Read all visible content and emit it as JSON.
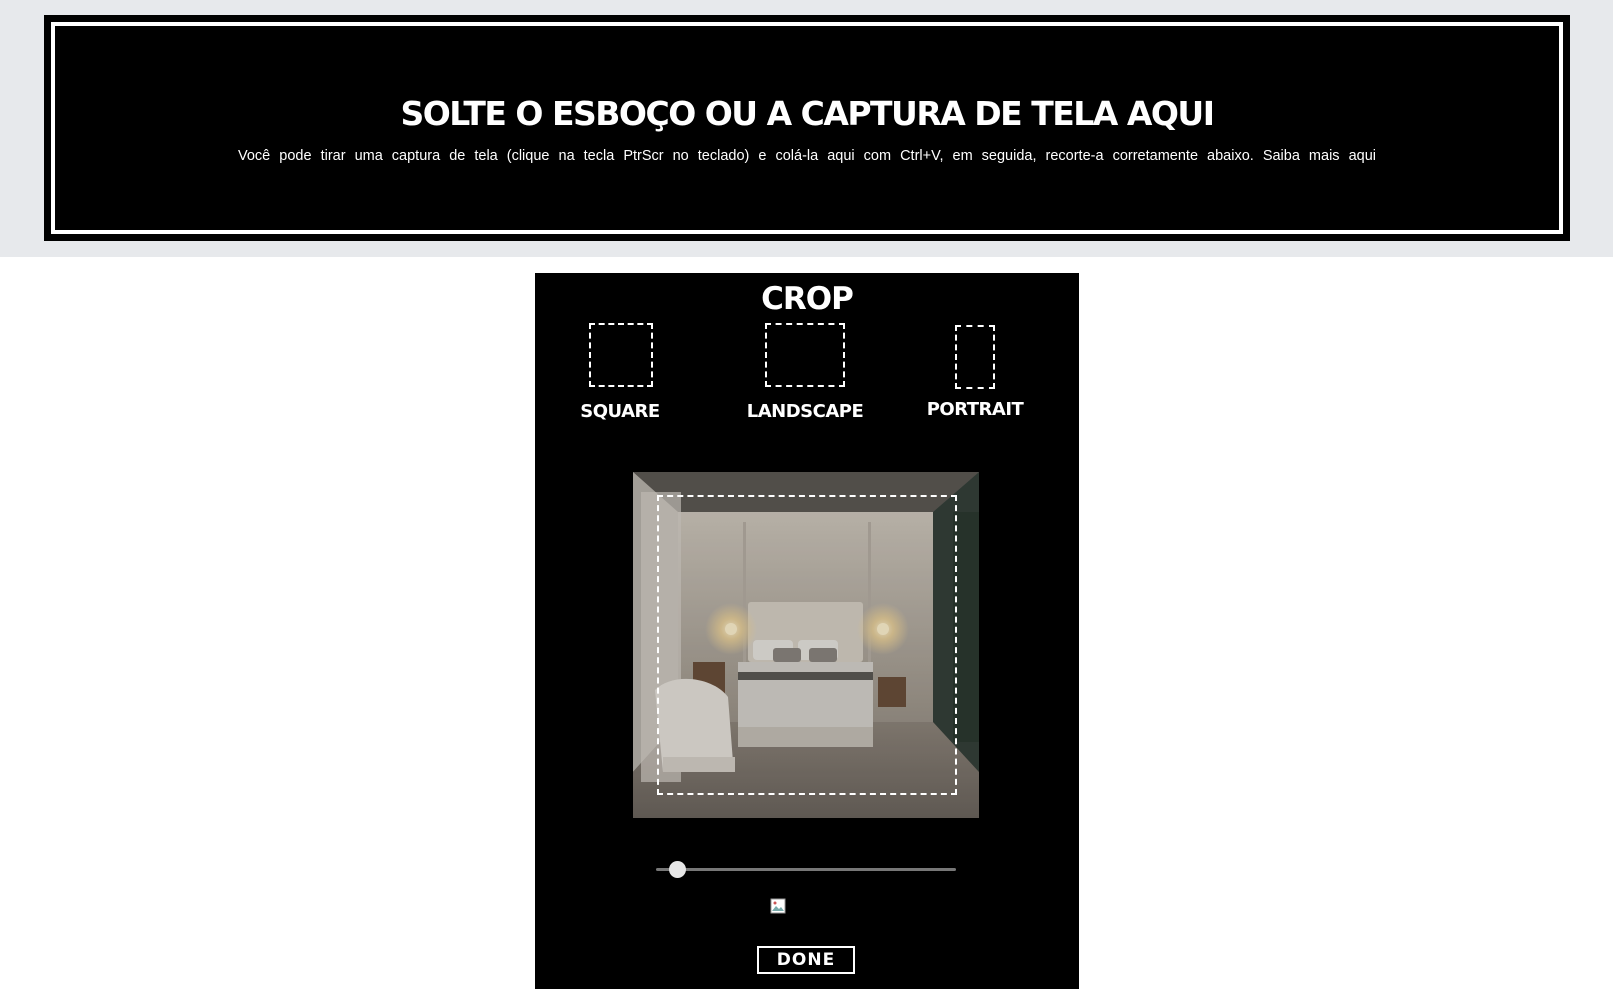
{
  "drop_zone": {
    "title": "SOLTE O ESBOÇO OU A CAPTURA DE TELA AQUI",
    "description": "Você pode tirar uma captura de tela (clique na tecla PtrScr no teclado) e colá-la aqui com Ctrl+V, em seguida, recorte-a corretamente abaixo. Saiba mais aqui"
  },
  "crop": {
    "title": "CROP",
    "options": [
      {
        "label": "SQUARE",
        "icon": "square-ratio-icon"
      },
      {
        "label": "LANDSCAPE",
        "icon": "landscape-ratio-icon"
      },
      {
        "label": "PORTRAIT",
        "icon": "portrait-ratio-icon"
      }
    ],
    "zoom_level": 0.07,
    "done_label": "DONE"
  },
  "colors": {
    "background": "#ffffff",
    "band": "#e7e9ec",
    "panel": "#000000",
    "accent": "#ffffff"
  }
}
